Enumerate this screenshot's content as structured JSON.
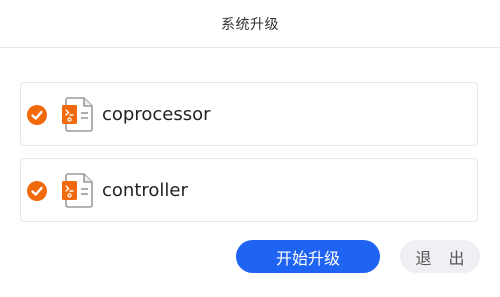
{
  "dialog": {
    "title": "系统升级"
  },
  "items": [
    {
      "label": "coprocessor",
      "checked": true,
      "icon": "file-icon"
    },
    {
      "label": "controller",
      "checked": true,
      "icon": "file-icon"
    }
  ],
  "buttons": {
    "start_label": "开始升级",
    "exit_label": "退 出"
  },
  "colors": {
    "accent": "#1f63f2",
    "check": "#f06a0c",
    "file_badge": "#f06a0c"
  }
}
